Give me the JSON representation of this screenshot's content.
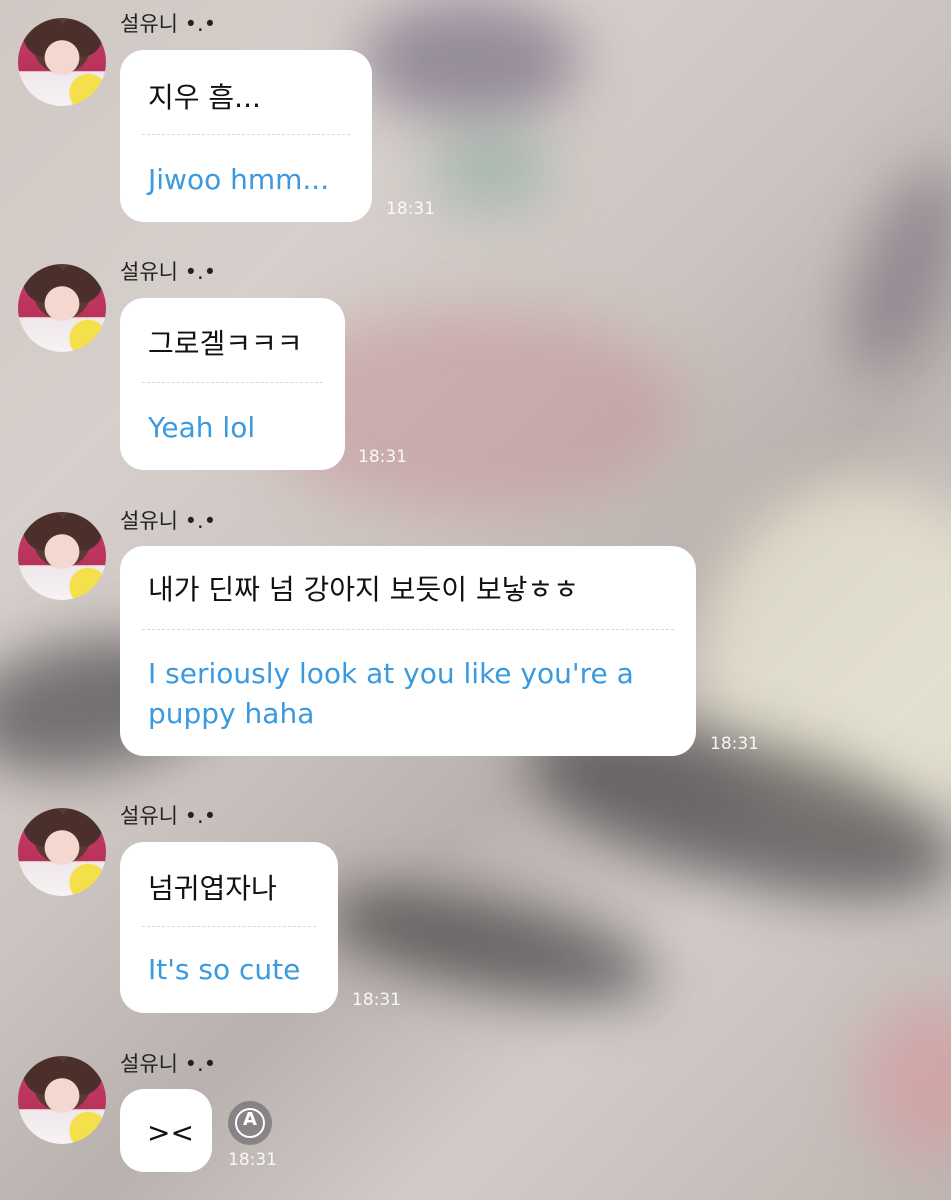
{
  "chat": {
    "messages": [
      {
        "sender": "설유니 •.•",
        "original": "지우 흠...",
        "translation": "Jiwoo hmm...",
        "time": "18:31"
      },
      {
        "sender": "설유니 •.•",
        "original": "그로겔ㅋㅋㅋ",
        "translation": "Yeah lol",
        "time": "18:31"
      },
      {
        "sender": "설유니 •.•",
        "original": "내가 딘짜 넘 강아지 보듯이 보낳ㅎㅎ",
        "translation": "I seriously look at you like you're a puppy haha",
        "time": "18:31"
      },
      {
        "sender": "설유니 •.•",
        "original": "넘귀엽자나",
        "translation": "It's so cute",
        "time": "18:31"
      },
      {
        "sender": "설유니 •.•",
        "original": "><",
        "time": "18:31",
        "translate_icon": "translate-A-icon",
        "translate_letter": "A"
      }
    ]
  },
  "colors": {
    "translation_text": "#3a9ae0",
    "bubble_bg": "#ffffff",
    "timestamp": "#ffffff"
  }
}
